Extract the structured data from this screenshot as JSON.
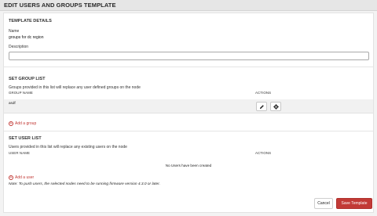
{
  "header": {
    "title": "EDIT USERS AND GROUPS TEMPLATE"
  },
  "details": {
    "section_title": "TEMPLATE DETAILS",
    "name_label": "Name",
    "name_value": "groups for dc region",
    "description_label": "Description",
    "description_value": "",
    "description_placeholder": ""
  },
  "groups": {
    "section_title": "SET GROUP LIST",
    "description": "Groups provided in this list will replace any user defined groups on the node",
    "col_name": "GROUP NAME",
    "col_actions": "ACTIONS",
    "rows": [
      {
        "name": "asdf"
      }
    ],
    "add_label": "Add a group"
  },
  "users": {
    "section_title": "SET USER LIST",
    "description": "Users provided in this list will replace any existing users on the node",
    "col_name": "USER NAME",
    "col_actions": "ACTIONS",
    "empty_text": "No Users have been created",
    "add_label": "Add a user",
    "note": "Note: To push users, the selected nodes need to be running firmware version 4.3.0 or later."
  },
  "footer": {
    "cancel_label": "Cancel",
    "save_label": "Save Template"
  },
  "icons": {
    "edit": "pencil-icon",
    "delete": "gear-delete-icon",
    "add": "plus-circle-icon"
  },
  "colors": {
    "accent": "#c23a36"
  }
}
